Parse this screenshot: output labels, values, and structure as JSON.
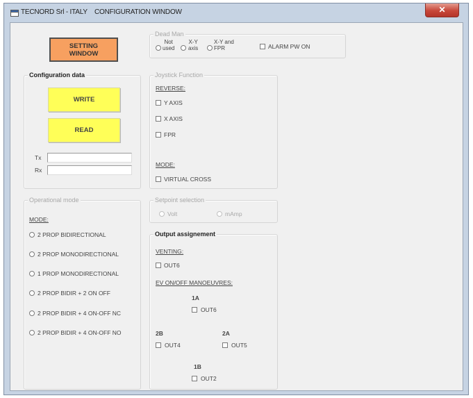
{
  "window": {
    "title": "TECNORD Srl - ITALY    CONFIGURATION WINDOW",
    "close_label": "✕"
  },
  "setting_window_button": {
    "line1": "SETTING",
    "line2": "WINDOW"
  },
  "dead_man": {
    "title": "Dead Man",
    "options": [
      {
        "line1": "Not",
        "line2": "used"
      },
      {
        "line1": "X-Y",
        "line2": "axis"
      },
      {
        "line1": "X-Y and",
        "line2": "FPR"
      }
    ],
    "alarm_label": "ALARM PW ON"
  },
  "configuration": {
    "title": "Configuration data",
    "write_label": "WRITE",
    "read_label": "READ",
    "tx_label": "Tx",
    "rx_label": "Rx",
    "tx_value": "",
    "rx_value": ""
  },
  "joystick": {
    "title": "Joystick Function",
    "reverse_label": "REVERSE:",
    "reverse_items": [
      "Y AXIS",
      "X AXIS",
      "FPR"
    ],
    "mode_label": "MODE:",
    "virtual_cross_label": "VIRTUAL CROSS"
  },
  "operational_mode": {
    "title": "Operational mode",
    "mode_label": "MODE:",
    "options": [
      "2 PROP BIDIRECTIONAL",
      "2 PROP MONODIRECTIONAL",
      "1 PROP MONODIRECTIONAL",
      "2 PROP BIDIR + 2 ON OFF",
      "2 PROP BIDIR + 4 ON-OFF NC",
      "2 PROP BIDIR + 4 ON-OFF NO"
    ]
  },
  "setpoint": {
    "title": "Setpoint selection",
    "options": [
      "Volt",
      "mAmp"
    ]
  },
  "output": {
    "title": "Output assignement",
    "venting_label": "VENTING:",
    "venting_out": "OUT6",
    "ev_label": "EV ON/OFF MANOEUVRES:",
    "label_1a": "1A",
    "out_1a": "OUT6",
    "label_2b": "2B",
    "out_2b": "OUT4",
    "label_2a": "2A",
    "out_2a": "OUT5",
    "label_1b": "1B",
    "out_1b": "OUT2"
  }
}
